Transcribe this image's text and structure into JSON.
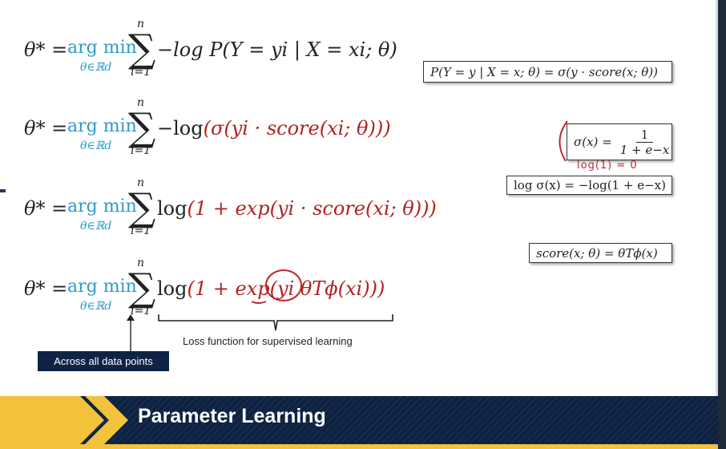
{
  "equations": [
    {
      "lhs": "θ* =",
      "argmin": "arg min",
      "under": "θ∈ℝd",
      "sum_top": "n",
      "sum_bottom": "i=1",
      "body": "−log P(Y = yi | X = xi; θ)"
    },
    {
      "lhs": "θ* =",
      "argmin": "arg min",
      "under": "θ∈ℝd",
      "sum_top": "n",
      "sum_bottom": "i=1",
      "body_pre": "−log",
      "body_red": "(σ(yi · score(xi; θ)))"
    },
    {
      "lhs": "θ* =",
      "argmin": "arg min",
      "under": "θ∈ℝd",
      "sum_top": "n",
      "sum_bottom": "i=1",
      "body_pre": "log",
      "body_red": "(1 + exp(yi · score(xi; θ)))"
    },
    {
      "lhs": "θ* =",
      "argmin": "arg min",
      "under": "θ∈ℝd",
      "sum_top": "n",
      "sum_bottom": "i=1",
      "body_pre": "log",
      "body_red": "(1 + exp(yi θTϕ(xi)))"
    }
  ],
  "boxes": {
    "prob": "P(Y = y | X = x; θ) = σ(y · score(x; θ))",
    "sigmoid_lhs": "σ(x) =",
    "sigmoid_num": "1",
    "sigmoid_den": "1 + e−x",
    "logsig": "log σ(x) = −log(1 + e−x)",
    "score": "score(x; θ) = θTϕ(x)"
  },
  "handwriting": "log(1) = 0",
  "caption": "Loss function for supervised learning",
  "label": "Across all data points",
  "banner_title": "Parameter Learning",
  "colors": {
    "accent_blue": "#2f9ac9",
    "accent_red": "#b22222",
    "banner_navy": "#0e2140",
    "banner_gold": "#f2c23a"
  }
}
